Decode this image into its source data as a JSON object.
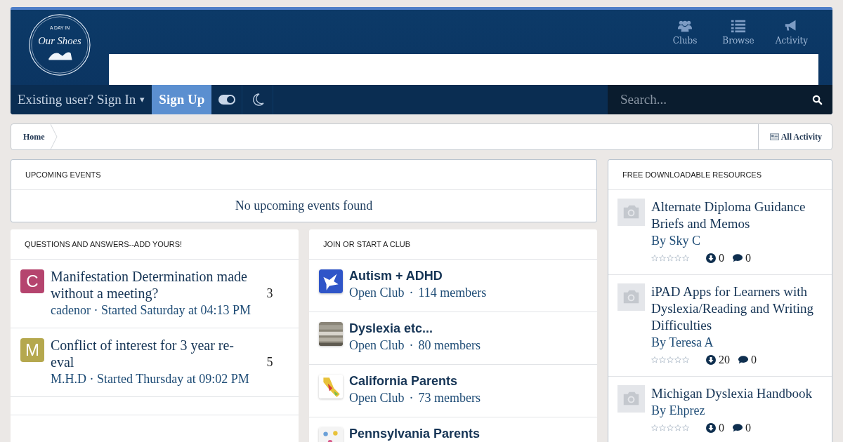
{
  "header": {
    "logo": {
      "line_1": "A DAY IN",
      "line_2": "Our Shoes"
    },
    "nav_links": [
      {
        "kind": "clubs",
        "label": "Clubs"
      },
      {
        "kind": "browse",
        "label": "Browse"
      },
      {
        "kind": "activity",
        "label": "Activity"
      }
    ]
  },
  "user_bar": {
    "sign_in": "Existing user? Sign In",
    "caret": "▾",
    "sign_up": "Sign Up",
    "theme_toggle": {
      "on": true
    },
    "search": {
      "placeholder": "Search..."
    }
  },
  "breadcrumb": {
    "items": [
      "Home"
    ],
    "all_activity": "All Activity"
  },
  "upcoming_events": {
    "title": "UPCOMING EVENTS",
    "empty_message": "No upcoming events found"
  },
  "questions": {
    "title": "QUESTIONS AND ANSWERS--ADD YOURS!",
    "topics": [
      {
        "avatar_letter": "C",
        "color": "#b5446e",
        "title": "Manifestation Determination made without a meeting?",
        "author": "cadenor",
        "separator": "·",
        "started": "Started Saturday at 04:13 PM",
        "replies": "3"
      },
      {
        "avatar_letter": "M",
        "color": "#b5a84e",
        "title": "Conflict of interest for 3 year re-eval",
        "author": "M.H.D",
        "separator": "·",
        "started": "Started Thursday at 09:02 PM",
        "replies": "5"
      }
    ]
  },
  "clubs": {
    "title": "JOIN OR START A CLUB",
    "items": [
      {
        "name": "Autism + ADHD",
        "type": "Open Club",
        "separator": "·",
        "members": "114 members"
      },
      {
        "name": "Dyslexia etc...",
        "type": "Open Club",
        "separator": "·",
        "members": "80 members"
      },
      {
        "name": "California Parents",
        "type": "Open Club",
        "separator": "·",
        "members": "73 members"
      },
      {
        "name": "Pennsylvania Parents"
      }
    ]
  },
  "resources": {
    "title": "FREE DOWNLOADABLE RESOURCES",
    "items": [
      {
        "title": "Alternate Diploma Guidance Briefs and Memos",
        "author": "By Sky C",
        "stars": 0,
        "downloads": "0",
        "comments": "0"
      },
      {
        "title": "iPAD Apps for Learners with Dyslexia/Reading and Writing Difficulties",
        "author": "By Teresa A",
        "stars": 0,
        "downloads": "20",
        "comments": "0"
      },
      {
        "title": "Michigan Dyslexia Handbook",
        "author": "By Ehprez",
        "stars": 0,
        "downloads": "0",
        "comments": "0"
      }
    ]
  }
}
